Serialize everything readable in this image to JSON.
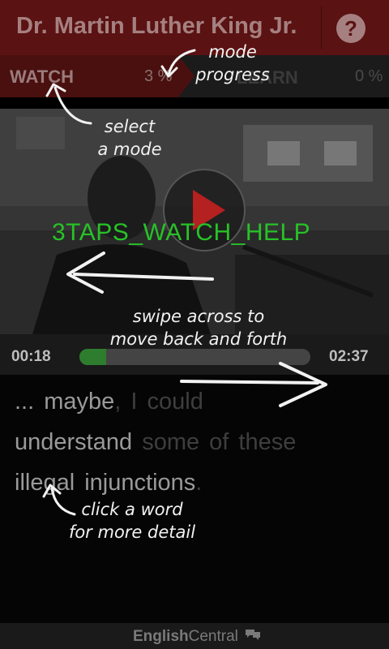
{
  "header": {
    "title": "Dr. Martin Luther King Jr.",
    "help_icon": "?"
  },
  "modes": {
    "watch_label": "WATCH",
    "watch_progress": "3 %",
    "learn_label": "LEARN",
    "learn_progress": "0 %"
  },
  "video": {
    "help_text": "3TAPS_WATCH_HELP",
    "play_icon": "play-icon"
  },
  "player": {
    "current_time": "00:18",
    "total_time": "02:37",
    "progress_fraction": 0.115
  },
  "transcript": {
    "line1": {
      "lead": "... ",
      "w1": "maybe",
      "w2": ", I could"
    },
    "line2": {
      "w1": "understand",
      "w2": "some of these"
    },
    "line3": {
      "w1": "illegal",
      "w2": "injunctions",
      "w3": "."
    }
  },
  "annotations": {
    "mode_progress": "mode\nprogress",
    "select_mode": "select\na mode",
    "swipe": "swipe across to\nmove back and forth",
    "click_word": "click a word\nfor more detail"
  },
  "footer": {
    "brand_strong": "English",
    "brand_rest": "Central"
  },
  "colors": {
    "header_bg": "#5a1212",
    "accent_green": "#27c227",
    "progress_fill": "#2e7d2e"
  }
}
